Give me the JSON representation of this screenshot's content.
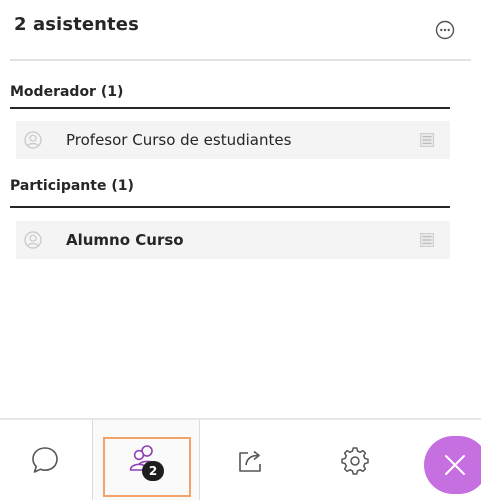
{
  "header": {
    "title": "2 asistentes",
    "more_icon": "ellipsis-circle-icon"
  },
  "sections": [
    {
      "title": "Moderador (1)",
      "attendees": [
        {
          "name": "Profesor Curso de estudiantes",
          "bold": false,
          "avatar_icon": "avatar-placeholder-icon",
          "menu_icon": "list-menu-icon"
        }
      ]
    },
    {
      "title": "Participante (1)",
      "attendees": [
        {
          "name": "Alumno Curso",
          "bold": true,
          "avatar_icon": "avatar-placeholder-icon",
          "menu_icon": "list-menu-icon"
        }
      ]
    }
  ],
  "footer": {
    "tabs": [
      {
        "id": "chat",
        "icon": "chat-bubble-icon",
        "selected": false
      },
      {
        "id": "attendees",
        "icon": "attendees-icon",
        "selected": true,
        "badge": "2"
      },
      {
        "id": "share",
        "icon": "share-content-icon",
        "selected": false
      },
      {
        "id": "settings",
        "icon": "gear-icon",
        "selected": false
      }
    ],
    "close_icon": "close-icon"
  },
  "colors": {
    "accent_purple": "#c66fe0",
    "focus_orange": "#f0a46a",
    "attendees_icon": "#8e3fb5",
    "row_background": "#f4f4f4"
  }
}
